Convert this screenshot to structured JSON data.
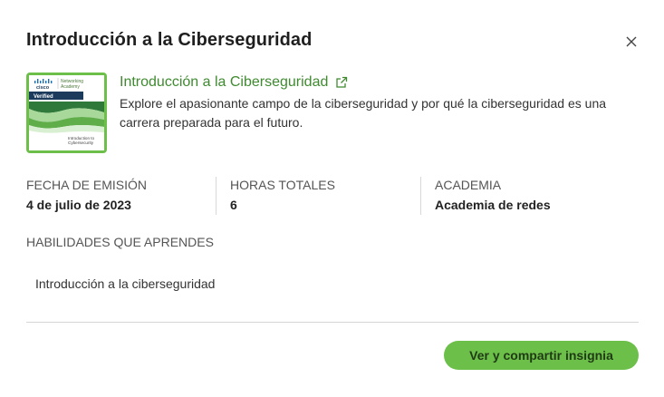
{
  "modal": {
    "title": "Introducción a la Ciberseguridad",
    "close_icon": "close-icon"
  },
  "badge": {
    "brand": "cisco",
    "program_line1": "Networking",
    "program_line2": "Academy",
    "status": "Verified",
    "caption_line1": "Introduction to",
    "caption_line2": "Cybersecurity",
    "colors": {
      "green": "#6cc04a",
      "dark_green": "#2f7a3a",
      "navy": "#1b3a5c"
    }
  },
  "course": {
    "name": "Introducción a la Ciberseguridad",
    "link_icon": "external-link-icon",
    "description": "Explore el apasionante campo de la ciberseguridad y por qué la ciberseguridad es una carrera preparada para el futuro."
  },
  "meta": {
    "issue_date_label": "FECHA DE EMISIÓN",
    "issue_date_value": "4 de julio de 2023",
    "hours_label": "HORAS TOTALES",
    "hours_value": "6",
    "academy_label": "ACADEMIA",
    "academy_value": "Academia de redes"
  },
  "skills": {
    "label": "HABILIDADES QUE APRENDES",
    "items": [
      "Introducción a la ciberseguridad"
    ]
  },
  "actions": {
    "share_label": "Ver y compartir insignia"
  },
  "colors": {
    "accent": "#6cc04a",
    "link": "#3f8a30"
  }
}
